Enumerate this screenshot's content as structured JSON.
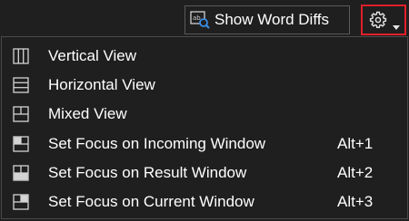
{
  "toolbar": {
    "word_diffs_label": "Show Word Diffs",
    "word_diffs_icon": "word-diff-search-icon",
    "settings_icon": "gear-icon",
    "settings_caret_icon": "caret-down-icon",
    "settings_highlight_color": "#e0202a"
  },
  "menu": {
    "items": [
      {
        "label": "Vertical View",
        "icon": "vertical-view-icon",
        "shortcut": ""
      },
      {
        "label": "Horizontal View",
        "icon": "horizontal-view-icon",
        "shortcut": ""
      },
      {
        "label": "Mixed View",
        "icon": "mixed-view-icon",
        "shortcut": ""
      },
      {
        "label": "Set Focus on Incoming Window",
        "icon": "focus-incoming-icon",
        "shortcut": "Alt+1"
      },
      {
        "label": "Set Focus on Result Window",
        "icon": "focus-result-icon",
        "shortcut": "Alt+2"
      },
      {
        "label": "Set Focus on Current Window",
        "icon": "focus-current-icon",
        "shortcut": "Alt+3"
      }
    ]
  }
}
